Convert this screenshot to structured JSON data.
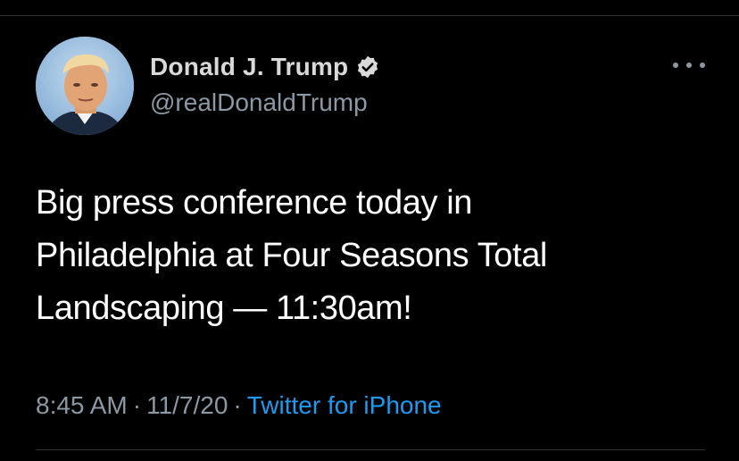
{
  "author": {
    "display_name": "Donald J. Trump",
    "handle": "@realDonaldTrump",
    "verified_icon": "verified-badge-icon",
    "avatar_icon": "profile-photo"
  },
  "tweet": {
    "text_lines": [
      "Big press conference today in",
      "Philadelphia at Four Seasons Total",
      "Landscaping — 11:30am!"
    ]
  },
  "meta": {
    "time": "8:45 AM",
    "separator": "·",
    "date": "11/7/20",
    "source": "Twitter for iPhone"
  },
  "menu": {
    "icon": "more-options-icon"
  },
  "colors": {
    "background": "#000000",
    "name": "#d9d9d9",
    "secondary": "#8b98a5",
    "link": "#1d9bf0",
    "divider": "#2f3336"
  }
}
